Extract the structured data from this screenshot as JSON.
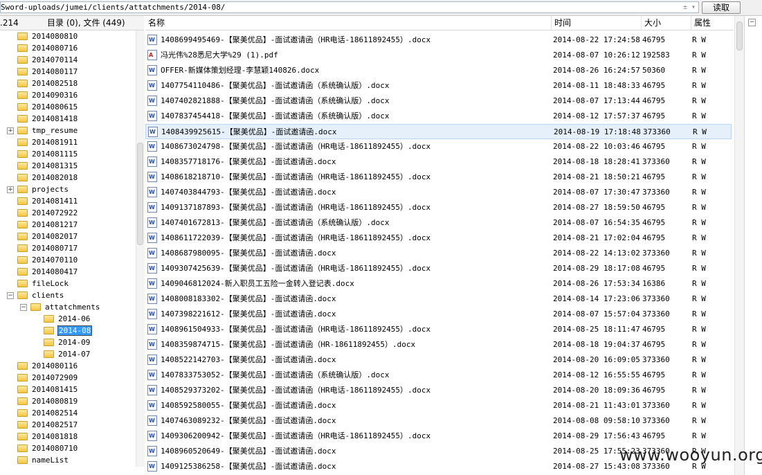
{
  "address": {
    "path": "Sword-uploads/jumei/clients/attatchments/2014-08/",
    "dropdown_glyphs": "± ▾",
    "read_button": "读取"
  },
  "tree_header": {
    "ip_fragment": ".214",
    "counts": "目录 (0), 文件 (449)"
  },
  "tree": [
    {
      "label": "2014080810",
      "depth": 1
    },
    {
      "label": "2014080716",
      "depth": 1
    },
    {
      "label": "2014070114",
      "depth": 1
    },
    {
      "label": "2014080117",
      "depth": 1
    },
    {
      "label": "2014082518",
      "depth": 1
    },
    {
      "label": "2014090316",
      "depth": 1
    },
    {
      "label": "2014080615",
      "depth": 1
    },
    {
      "label": "2014081418",
      "depth": 1
    },
    {
      "label": "tmp_resume",
      "depth": 1,
      "expander": "+"
    },
    {
      "label": "2014081911",
      "depth": 1
    },
    {
      "label": "2014081115",
      "depth": 1
    },
    {
      "label": "2014081315",
      "depth": 1
    },
    {
      "label": "2014082018",
      "depth": 1
    },
    {
      "label": "projects",
      "depth": 1,
      "expander": "+"
    },
    {
      "label": "2014081411",
      "depth": 1
    },
    {
      "label": "2014072922",
      "depth": 1
    },
    {
      "label": "2014081217",
      "depth": 1
    },
    {
      "label": "2014082017",
      "depth": 1
    },
    {
      "label": "2014080717",
      "depth": 1
    },
    {
      "label": "2014070110",
      "depth": 1
    },
    {
      "label": "2014080417",
      "depth": 1
    },
    {
      "label": "fileLock",
      "depth": 1
    },
    {
      "label": "clients",
      "depth": 1,
      "expander": "−"
    },
    {
      "label": "attatchments",
      "depth": 2,
      "expander": "−"
    },
    {
      "label": "2014-06",
      "depth": 3
    },
    {
      "label": "2014-08",
      "depth": 3,
      "selected": true
    },
    {
      "label": "2014-09",
      "depth": 3
    },
    {
      "label": "2014-07",
      "depth": 3
    },
    {
      "label": "2014080116",
      "depth": 1
    },
    {
      "label": "2014072909",
      "depth": 1
    },
    {
      "label": "2014081415",
      "depth": 1
    },
    {
      "label": "2014080819",
      "depth": 1
    },
    {
      "label": "2014082514",
      "depth": 1
    },
    {
      "label": "2014082517",
      "depth": 1
    },
    {
      "label": "2014081818",
      "depth": 1
    },
    {
      "label": "2014080710",
      "depth": 1
    },
    {
      "label": "nameList",
      "depth": 1
    }
  ],
  "columns": {
    "name": "名称",
    "time": "时间",
    "size": "大小",
    "attr": "属性"
  },
  "files": [
    {
      "name": "1408699495469-【聚美优品】-面试邀请函（HR电话-18611892455）.docx",
      "time": "2014-08-22 17:24:58",
      "size": "46795",
      "attr": "R W",
      "type": "doc"
    },
    {
      "name": "冯光伟%28悉尼大学%29 (1).pdf",
      "time": "2014-08-07 10:26:12",
      "size": "192583",
      "attr": "R W",
      "type": "pdf"
    },
    {
      "name": "OFFER-新媒体策划经理-李慧颖140826.docx",
      "time": "2014-08-26 16:24:57",
      "size": "50360",
      "attr": "R W",
      "type": "doc"
    },
    {
      "name": "1407754110486-【聚美优品】-面试邀请函（系统确认版）.docx",
      "time": "2014-08-11 18:48:33",
      "size": "46795",
      "attr": "R W",
      "type": "doc"
    },
    {
      "name": "1407402821888-【聚美优品】-面试邀请函（系统确认版）.docx",
      "time": "2014-08-07 17:13:44",
      "size": "46795",
      "attr": "R W",
      "type": "doc"
    },
    {
      "name": "1407837454418-【聚美优品】-面试邀请函（系统确认版）.docx",
      "time": "2014-08-12 17:57:37",
      "size": "46795",
      "attr": "R W",
      "type": "doc"
    },
    {
      "name": "1408439925615-【聚美优品】-面试邀请函.docx",
      "time": "2014-08-19 17:18:48",
      "size": "373360",
      "attr": "R W",
      "type": "doc",
      "selected": true
    },
    {
      "name": "1408673024798-【聚美优品】-面试邀请函（HR电话-18611892455）.docx",
      "time": "2014-08-22 10:03:46",
      "size": "46795",
      "attr": "R W",
      "type": "doc"
    },
    {
      "name": "1408357718176-【聚美优品】-面试邀请函.docx",
      "time": "2014-08-18 18:28:41",
      "size": "373360",
      "attr": "R W",
      "type": "doc"
    },
    {
      "name": "1408618218710-【聚美优品】-面试邀请函（HR电话-18611892455）.docx",
      "time": "2014-08-21 18:50:21",
      "size": "46795",
      "attr": "R W",
      "type": "doc"
    },
    {
      "name": "1407403844793-【聚美优品】-面试邀请函.docx",
      "time": "2014-08-07 17:30:47",
      "size": "373360",
      "attr": "R W",
      "type": "doc"
    },
    {
      "name": "1409137187893-【聚美优品】-面试邀请函（HR电话-18611892455）.docx",
      "time": "2014-08-27 18:59:50",
      "size": "46795",
      "attr": "R W",
      "type": "doc"
    },
    {
      "name": "1407401672813-【聚美优品】-面试邀请函（系统确认版）.docx",
      "time": "2014-08-07 16:54:35",
      "size": "46795",
      "attr": "R W",
      "type": "doc"
    },
    {
      "name": "1408611722039-【聚美优品】-面试邀请函（HR电话-18611892455）.docx",
      "time": "2014-08-21 17:02:04",
      "size": "46795",
      "attr": "R W",
      "type": "doc"
    },
    {
      "name": "1408687980095-【聚美优品】-面试邀请函.docx",
      "time": "2014-08-22 14:13:02",
      "size": "373360",
      "attr": "R W",
      "type": "doc"
    },
    {
      "name": "1409307425639-【聚美优品】-面试邀请函（HR电话-18611892455）.docx",
      "time": "2014-08-29 18:17:08",
      "size": "46795",
      "attr": "R W",
      "type": "doc"
    },
    {
      "name": "1409046812024-新入职员工五险一金转入登记表.docx",
      "time": "2014-08-26 17:53:34",
      "size": "16386",
      "attr": "R W",
      "type": "doc"
    },
    {
      "name": "1408008183302-【聚美优品】-面试邀请函.docx",
      "time": "2014-08-14 17:23:06",
      "size": "373360",
      "attr": "R W",
      "type": "doc"
    },
    {
      "name": "1407398221612-【聚美优品】-面试邀请函.docx",
      "time": "2014-08-07 15:57:04",
      "size": "373360",
      "attr": "R W",
      "type": "doc"
    },
    {
      "name": "1408961504933-【聚美优品】-面试邀请函（HR电话-18611892455）.docx",
      "time": "2014-08-25 18:11:47",
      "size": "46795",
      "attr": "R W",
      "type": "doc"
    },
    {
      "name": "1408359874715-【聚美优品】-面试邀请函（HR-18611892455）.docx",
      "time": "2014-08-18 19:04:37",
      "size": "46795",
      "attr": "R W",
      "type": "doc"
    },
    {
      "name": "1408522142703-【聚美优品】-面试邀请函.docx",
      "time": "2014-08-20 16:09:05",
      "size": "373360",
      "attr": "R W",
      "type": "doc"
    },
    {
      "name": "1407833753052-【聚美优品】-面试邀请函（系统确认版）.docx",
      "time": "2014-08-12 16:55:55",
      "size": "46795",
      "attr": "R W",
      "type": "doc"
    },
    {
      "name": "1408529373202-【聚美优品】-面试邀请函（HR电话-18611892455）.docx",
      "time": "2014-08-20 18:09:36",
      "size": "46795",
      "attr": "R W",
      "type": "doc"
    },
    {
      "name": "1408592580055-【聚美优品】-面试邀请函.docx",
      "time": "2014-08-21 11:43:01",
      "size": "373360",
      "attr": "R W",
      "type": "doc"
    },
    {
      "name": "1407463089232-【聚美优品】-面试邀请函.docx",
      "time": "2014-08-08 09:58:10",
      "size": "373360",
      "attr": "R W",
      "type": "doc"
    },
    {
      "name": "1409306200942-【聚美优品】-面试邀请函（HR电话-18611892455）.docx",
      "time": "2014-08-29 17:56:43",
      "size": "46795",
      "attr": "R W",
      "type": "doc"
    },
    {
      "name": "1408960520649-【聚美优品】-面试邀请函.docx",
      "time": "2014-08-25 17:55:23",
      "size": "373360",
      "attr": "R W",
      "type": "doc"
    },
    {
      "name": "1409125386258-【聚美优品】-面试邀请函.docx",
      "time": "2014-08-27 15:43:08",
      "size": "373360",
      "attr": "R W",
      "type": "doc"
    }
  ],
  "side_panel": {
    "expander": "−"
  },
  "watermark": "www.wooyun.org"
}
